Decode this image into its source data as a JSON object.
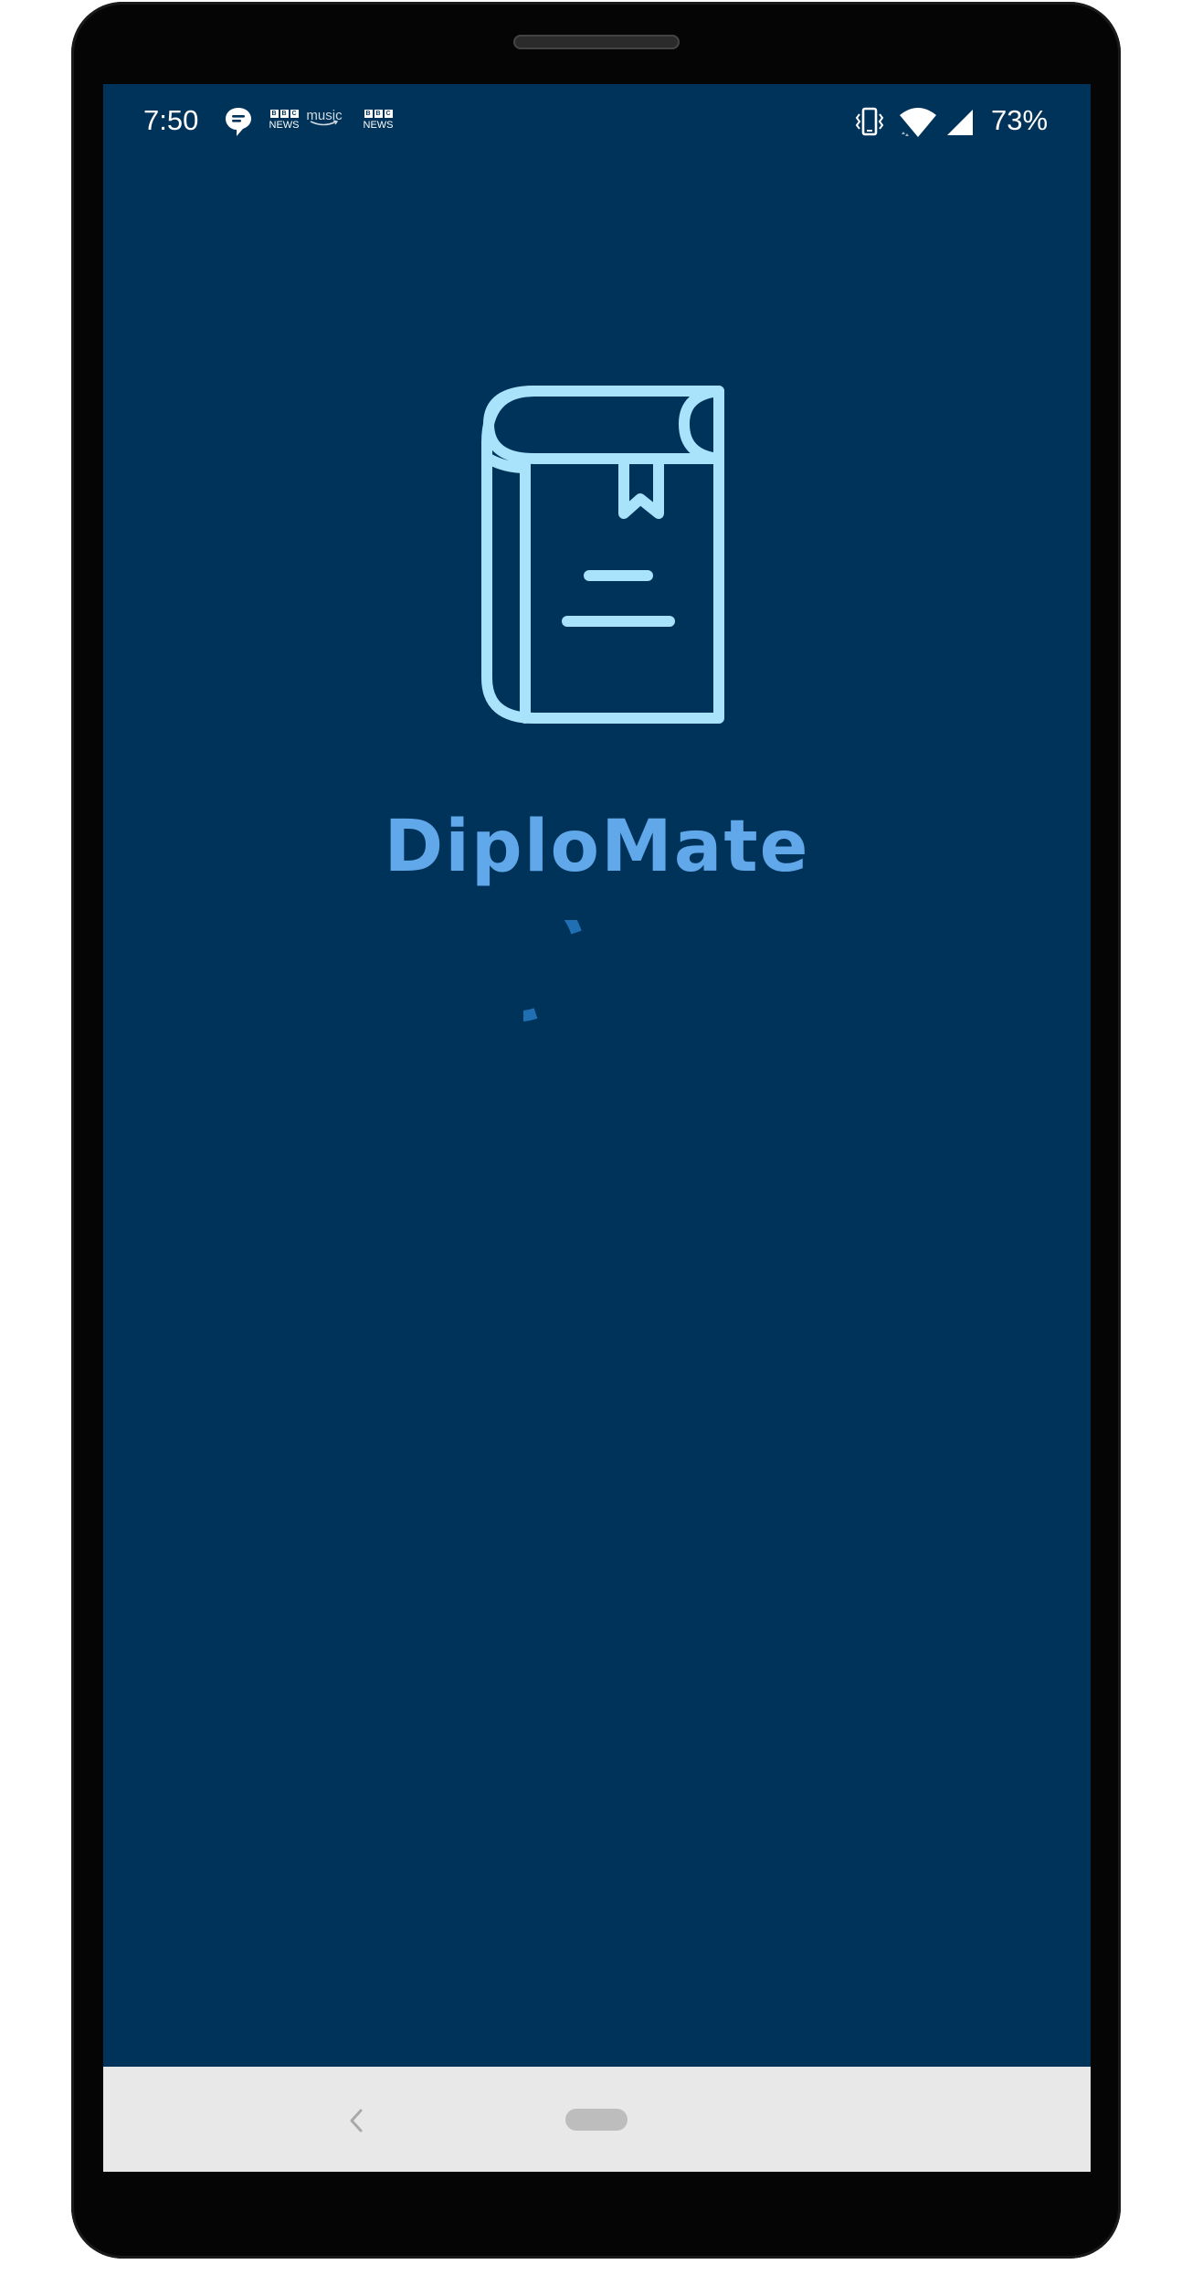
{
  "status_bar": {
    "time": "7:50",
    "notifications": {
      "bbc_1": {
        "letters": [
          "B",
          "B",
          "C"
        ],
        "label": "NEWS"
      },
      "music": {
        "label": "music"
      },
      "bbc_2": {
        "letters": [
          "B",
          "B",
          "C"
        ],
        "label": "NEWS"
      }
    },
    "battery_percent": "73%",
    "icons": [
      "message-bubble-icon",
      "bbc-news-icon",
      "amazon-music-icon",
      "bbc-news-icon",
      "vibrate-icon",
      "wifi-icon",
      "cell-signal-icon"
    ]
  },
  "splash": {
    "app_name": "DiploMate",
    "logo_icon": "book-bookmark-icon",
    "spinner_progress": 0.75
  },
  "navigation": {
    "back_icon": "chevron-left-icon",
    "home_icon": "home-pill-icon"
  },
  "colors": {
    "screen_background": "#00335a",
    "logo": "#a8e2fb",
    "app_name": "#60a8ea",
    "spinner": "#1f6fb2",
    "nav_bar": "#e8e8e8"
  }
}
